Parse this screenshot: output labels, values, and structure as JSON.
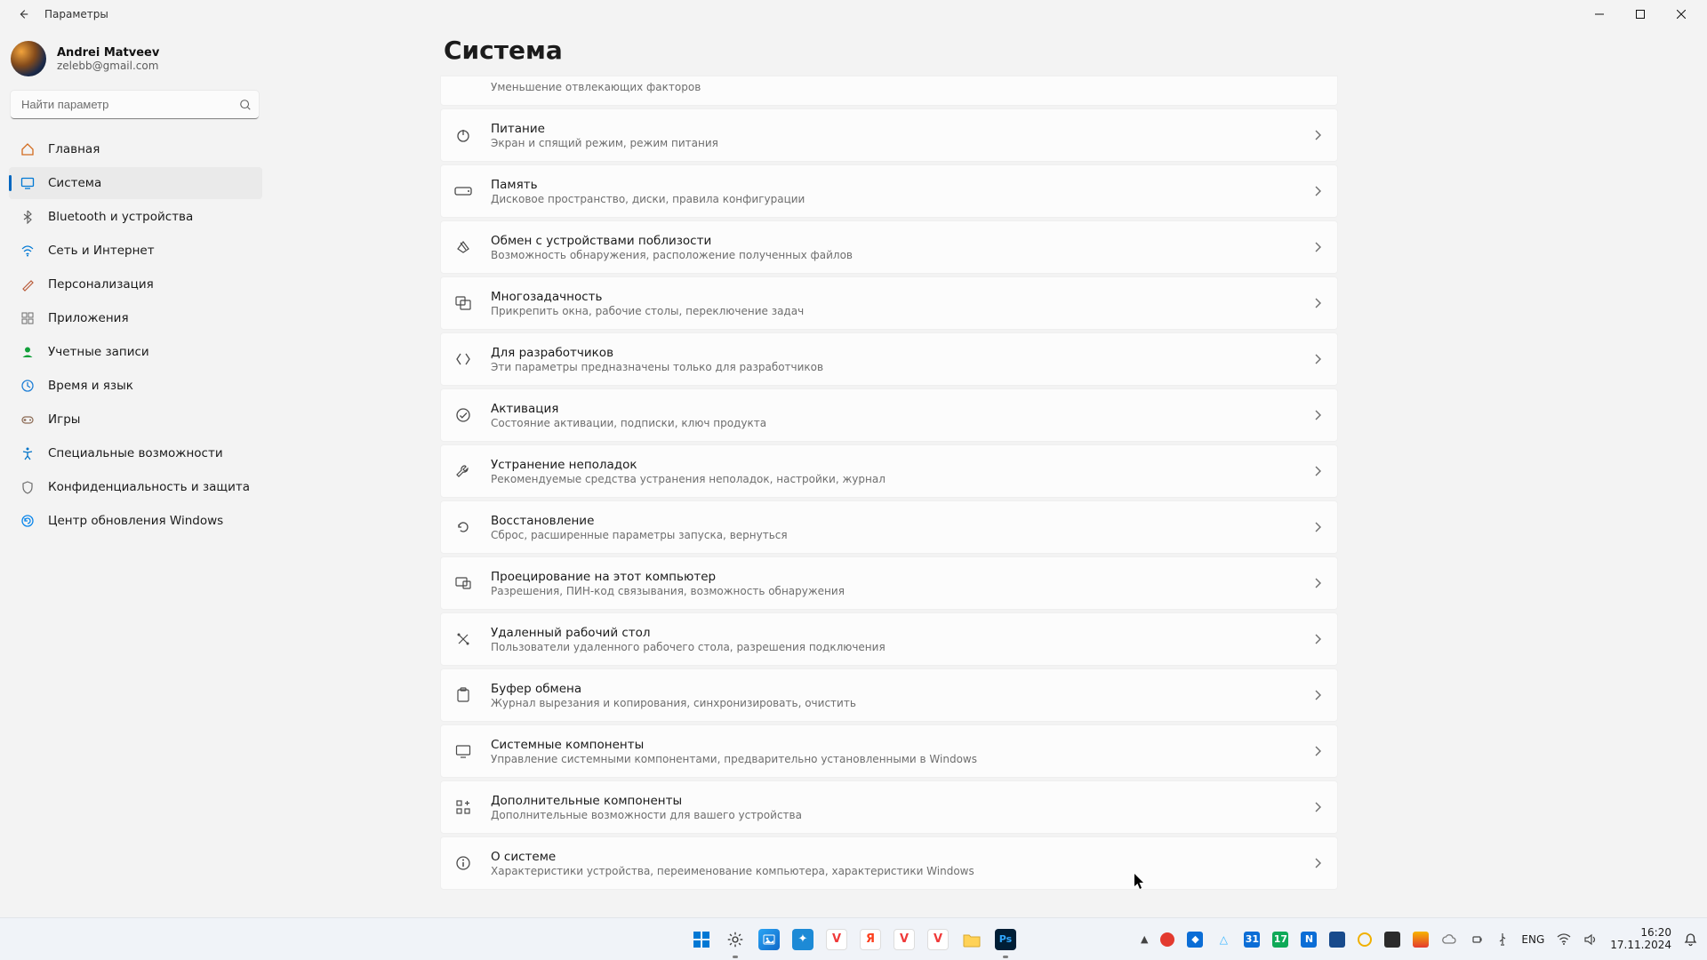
{
  "window": {
    "title": "Параметры"
  },
  "user": {
    "name": "Andrei Matveev",
    "email": "zelebb@gmail.com"
  },
  "search": {
    "placeholder": "Найти параметр"
  },
  "sidebar": {
    "items": [
      {
        "id": "home",
        "label": "Главная"
      },
      {
        "id": "system",
        "label": "Система",
        "active": true
      },
      {
        "id": "bluetooth",
        "label": "Bluetooth и устройства"
      },
      {
        "id": "network",
        "label": "Сеть и Интернет"
      },
      {
        "id": "personalization",
        "label": "Персонализация"
      },
      {
        "id": "apps",
        "label": "Приложения"
      },
      {
        "id": "accounts",
        "label": "Учетные записи"
      },
      {
        "id": "time",
        "label": "Время и язык"
      },
      {
        "id": "games",
        "label": "Игры"
      },
      {
        "id": "accessibility",
        "label": "Специальные возможности"
      },
      {
        "id": "privacy",
        "label": "Конфиденциальность и защита"
      },
      {
        "id": "windowsupdate",
        "label": "Центр обновления Windows"
      }
    ]
  },
  "page": {
    "title": "Система"
  },
  "cards": [
    {
      "id": "focus",
      "title": "",
      "sub": "Уменьшение отвлекающих факторов",
      "partial": true
    },
    {
      "id": "power",
      "title": "Питание",
      "sub": "Экран и спящий режим, режим питания"
    },
    {
      "id": "storage",
      "title": "Память",
      "sub": "Дисковое пространство, диски, правила конфигурации"
    },
    {
      "id": "nearby",
      "title": "Обмен с устройствами поблизости",
      "sub": "Возможность обнаружения, расположение полученных файлов"
    },
    {
      "id": "multitask",
      "title": "Многозадачность",
      "sub": "Прикрепить окна, рабочие столы, переключение задач"
    },
    {
      "id": "fordev",
      "title": "Для разработчиков",
      "sub": "Эти параметры предназначены только для разработчиков"
    },
    {
      "id": "activation",
      "title": "Активация",
      "sub": "Состояние активации, подписки, ключ продукта"
    },
    {
      "id": "troubleshoot",
      "title": "Устранение неполадок",
      "sub": "Рекомендуемые средства устранения неполадок, настройки, журнал"
    },
    {
      "id": "recovery",
      "title": "Восстановление",
      "sub": "Сброс, расширенные параметры запуска, вернуться"
    },
    {
      "id": "project",
      "title": "Проецирование на этот компьютер",
      "sub": "Разрешения, ПИН-код связывания, возможность обнаружения"
    },
    {
      "id": "remotedesktop",
      "title": "Удаленный рабочий стол",
      "sub": "Пользователи удаленного рабочего стола, разрешения подключения"
    },
    {
      "id": "clipboard",
      "title": "Буфер обмена",
      "sub": "Журнал вырезания и копирования, синхронизировать, очистить"
    },
    {
      "id": "syscomponents",
      "title": "Системные компоненты",
      "sub": "Управление системными компонентами, предварительно установленными в Windows"
    },
    {
      "id": "optional",
      "title": "Дополнительные компоненты",
      "sub": "Дополнительные возможности для вашего устройства"
    },
    {
      "id": "about",
      "title": "О системе",
      "sub": "Характеристики устройства, переименование компьютера, характеристики Windows"
    }
  ],
  "taskbar": {
    "tray": {
      "lang": "ENG",
      "time": "16:20",
      "date": "17.11.2024"
    }
  }
}
